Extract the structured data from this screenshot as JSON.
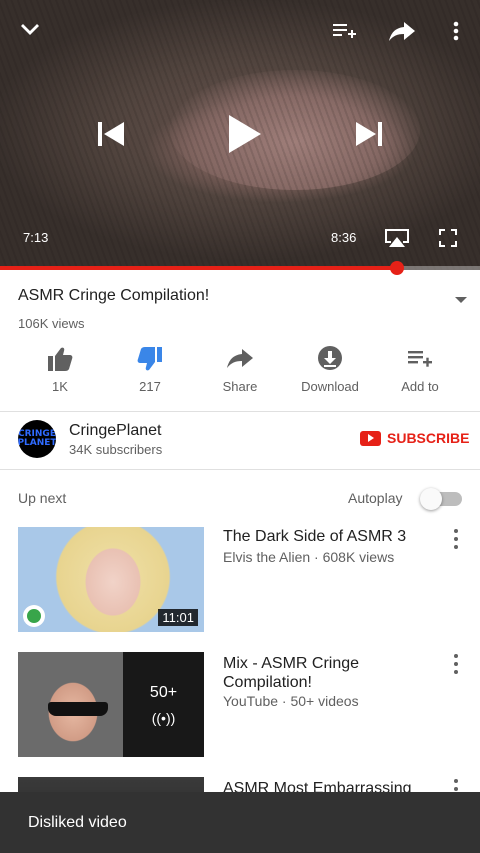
{
  "player": {
    "current_time": "7:13",
    "total_time": "8:36",
    "progress_fraction": 0.828
  },
  "video": {
    "title": "ASMR Cringe Compilation!",
    "views": "106K views"
  },
  "actions": [
    {
      "label": "1K",
      "icon": "thumbs-up-icon"
    },
    {
      "label": "217",
      "icon": "thumbs-down-icon"
    },
    {
      "label": "Share",
      "icon": "share-icon"
    },
    {
      "label": "Download",
      "icon": "download-icon"
    },
    {
      "label": "Add to",
      "icon": "add-to-playlist-icon"
    }
  ],
  "channel": {
    "name": "CringePlanet",
    "subscribers": "34K subscribers",
    "avatar_text_1": "CRINGE",
    "avatar_text_2": "PLANET",
    "subscribe_label": "SUBSCRIBE"
  },
  "up_next": {
    "label": "Up next",
    "autoplay_label": "Autoplay",
    "autoplay_on": false
  },
  "videos": [
    {
      "title": "The Dark Side of ASMR 3",
      "meta": "Elvis the Alien · 608K views",
      "duration": "11:01"
    },
    {
      "title": "Mix - ASMR Cringe Compilation!",
      "meta": "YouTube · 50+ videos",
      "overlay_count": "50+"
    },
    {
      "title": "ASMR Most Embarrassing"
    }
  ],
  "snackbar": {
    "message": "Disliked video"
  },
  "colors": {
    "accent_red": "#e62117",
    "dislike_active": "#3a86e8",
    "snackbar_bg": "#323232"
  }
}
